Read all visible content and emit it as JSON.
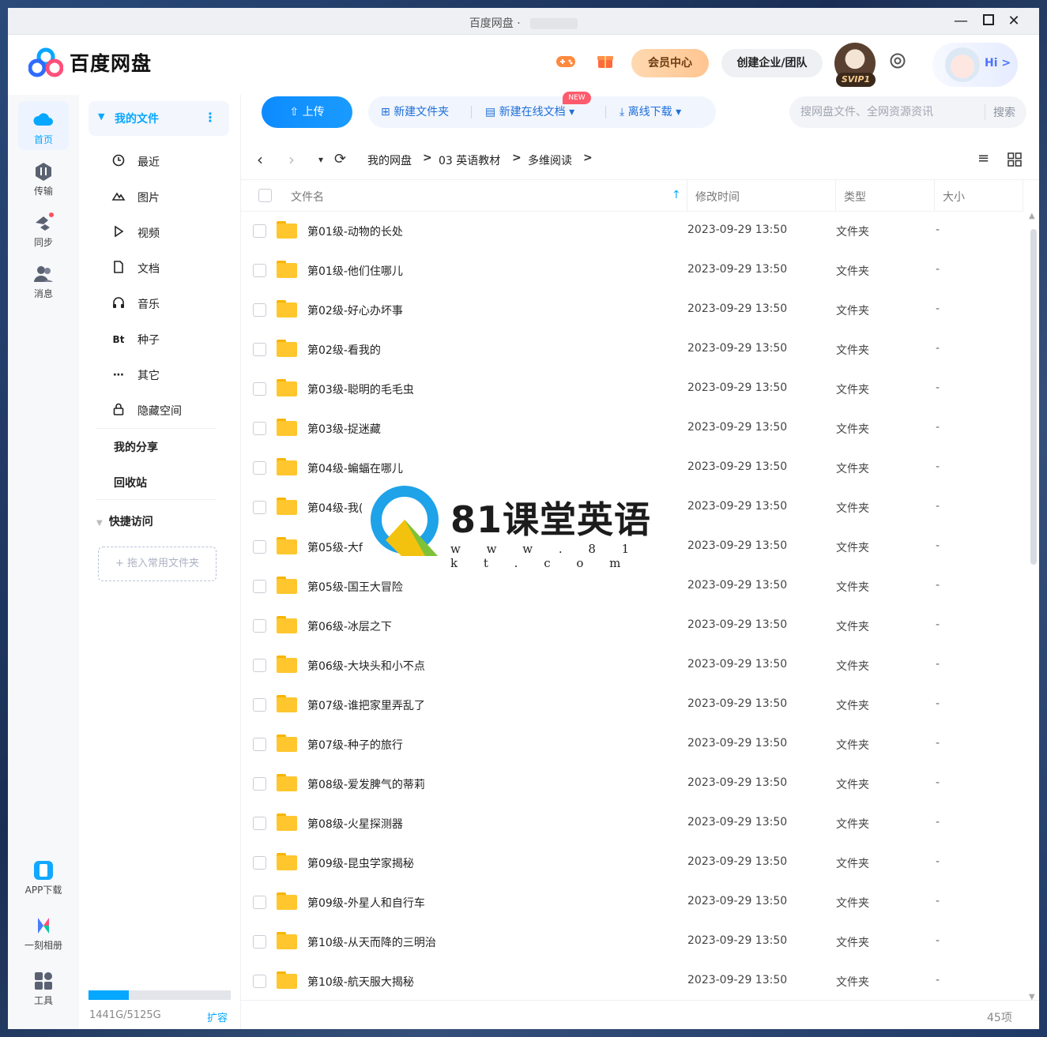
{
  "window": {
    "title": "百度网盘",
    "title_suffix": "·",
    "controls": [
      "minimize-icon",
      "maximize-icon",
      "close-icon"
    ]
  },
  "header": {
    "logo_text": "百度网盘",
    "game_icon": "gamepad-icon",
    "gift_icon": "gift-icon",
    "vip_center": "会员中心",
    "create_team": "创建企业/团队",
    "svip_badge": "SVIP1",
    "settings_icon": "settings-icon",
    "hi_label": "Hi >",
    "accent": "#06a7ff"
  },
  "leftnav": {
    "items": [
      {
        "label": "首页",
        "icon": "cloud-icon",
        "active": true
      },
      {
        "label": "传输",
        "icon": "transfer-icon"
      },
      {
        "label": "同步",
        "icon": "sync-icon"
      },
      {
        "label": "消息",
        "icon": "message-icon"
      }
    ],
    "bottom": [
      {
        "label": "APP下载",
        "icon": "phone-icon"
      },
      {
        "label": "一刻相册",
        "icon": "album-icon"
      },
      {
        "label": "工具",
        "icon": "tools-icon"
      }
    ]
  },
  "sidebar": {
    "my_files": "我的文件",
    "items": [
      {
        "label": "最近",
        "icon": "clock-icon"
      },
      {
        "label": "图片",
        "icon": "image-icon"
      },
      {
        "label": "视频",
        "icon": "play-icon"
      },
      {
        "label": "文档",
        "icon": "document-icon"
      },
      {
        "label": "音乐",
        "icon": "headphones-icon"
      },
      {
        "label": "种子",
        "icon": "bt-icon"
      },
      {
        "label": "其它",
        "icon": "ellipsis-icon"
      },
      {
        "label": "隐藏空间",
        "icon": "lock-icon"
      }
    ],
    "my_share": "我的分享",
    "recycle": "回收站",
    "quick_access": "快捷访问",
    "drop_hint": "+ 拖入常用文件夹",
    "storage_text": "1441G/5125G",
    "storage_used_fraction": 0.281,
    "expand": "扩容"
  },
  "toolbar": {
    "upload": "上传",
    "new_folder": "新建文件夹",
    "new_online_doc": "新建在线文档",
    "new_badge": "NEW",
    "offline_download": "离线下载",
    "search_placeholder": "搜网盘文件、全网资源资讯",
    "search_button": "搜索"
  },
  "breadcrumb": {
    "items": [
      "我的网盘",
      "03 英语教材",
      "多维阅读"
    ]
  },
  "table": {
    "headers": {
      "name": "文件名",
      "time": "修改时间",
      "type": "类型",
      "size": "大小"
    },
    "rows": [
      {
        "name": "第01级-动物的长处",
        "time": "2023-09-29 13:50",
        "type": "文件夹",
        "size": "-"
      },
      {
        "name": "第01级-他们住哪儿",
        "time": "2023-09-29 13:50",
        "type": "文件夹",
        "size": "-"
      },
      {
        "name": "第02级-好心办坏事",
        "time": "2023-09-29 13:50",
        "type": "文件夹",
        "size": "-"
      },
      {
        "name": "第02级-看我的",
        "time": "2023-09-29 13:50",
        "type": "文件夹",
        "size": "-"
      },
      {
        "name": "第03级-聪明的毛毛虫",
        "time": "2023-09-29 13:50",
        "type": "文件夹",
        "size": "-"
      },
      {
        "name": "第03级-捉迷藏",
        "time": "2023-09-29 13:50",
        "type": "文件夹",
        "size": "-"
      },
      {
        "name": "第04级-蝙蝠在哪儿",
        "time": "2023-09-29 13:50",
        "type": "文件夹",
        "size": "-"
      },
      {
        "name": "第04级-我(",
        "time": "2023-09-29 13:50",
        "type": "文件夹",
        "size": "-"
      },
      {
        "name": "第05级-大f",
        "time": "2023-09-29 13:50",
        "type": "文件夹",
        "size": "-"
      },
      {
        "name": "第05级-国王大冒险",
        "time": "2023-09-29 13:50",
        "type": "文件夹",
        "size": "-"
      },
      {
        "name": "第06级-冰层之下",
        "time": "2023-09-29 13:50",
        "type": "文件夹",
        "size": "-"
      },
      {
        "name": "第06级-大块头和小不点",
        "time": "2023-09-29 13:50",
        "type": "文件夹",
        "size": "-"
      },
      {
        "name": "第07级-谁把家里弄乱了",
        "time": "2023-09-29 13:50",
        "type": "文件夹",
        "size": "-"
      },
      {
        "name": "第07级-种子的旅行",
        "time": "2023-09-29 13:50",
        "type": "文件夹",
        "size": "-"
      },
      {
        "name": "第08级-爱发脾气的蒂莉",
        "time": "2023-09-29 13:50",
        "type": "文件夹",
        "size": "-"
      },
      {
        "name": "第08级-火星探测器",
        "time": "2023-09-29 13:50",
        "type": "文件夹",
        "size": "-"
      },
      {
        "name": "第09级-昆虫学家揭秘",
        "time": "2023-09-29 13:50",
        "type": "文件夹",
        "size": "-"
      },
      {
        "name": "第09级-外星人和自行车",
        "time": "2023-09-29 13:50",
        "type": "文件夹",
        "size": "-"
      },
      {
        "name": "第10级-从天而降的三明治",
        "time": "2023-09-29 13:50",
        "type": "文件夹",
        "size": "-"
      },
      {
        "name": "第10级-航天服大揭秘",
        "time": "2023-09-29 13:50",
        "type": "文件夹",
        "size": "-"
      }
    ],
    "count": "45项"
  },
  "watermark": {
    "title": "81课堂英语",
    "url": "w w w . 8 1 k t . c o m"
  }
}
